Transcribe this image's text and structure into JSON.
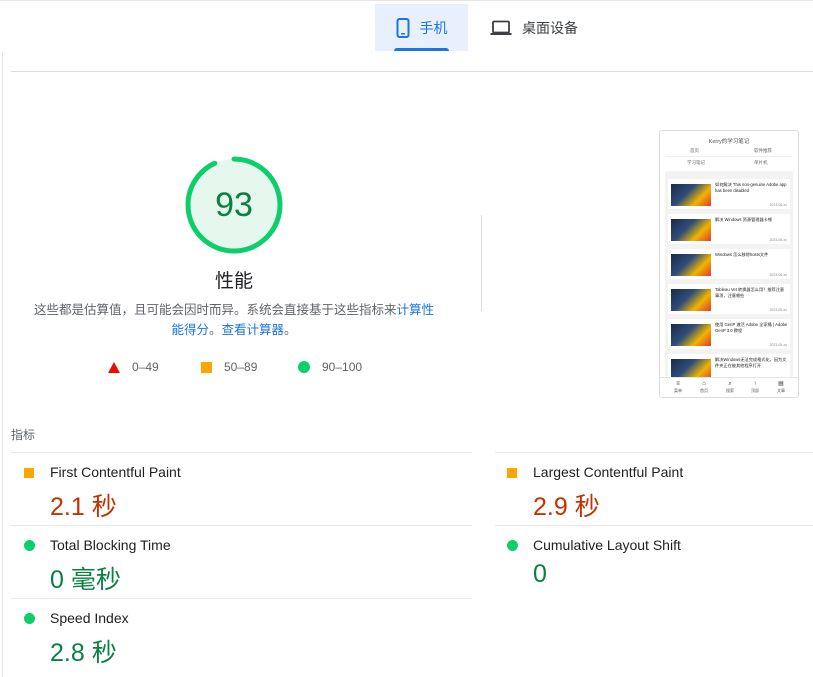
{
  "tabs": {
    "mobile": {
      "label": "手机",
      "icon": "smartphone-icon",
      "active": true
    },
    "desktop": {
      "label": "桌面设备",
      "icon": "laptop-icon",
      "active": false
    }
  },
  "gauge": {
    "score": "93",
    "score_value": 93,
    "title": "性能",
    "desc_prefix": "这些都是估算值，且可能会因时而异。系统会直接基于这些指标来",
    "desc_link1": "计算性能得分",
    "desc_mid": "。",
    "desc_link2": "查看计算器",
    "desc_suffix": "。",
    "color": "#0cce6b"
  },
  "legend": [
    {
      "label": "0–49",
      "shape": "triangle",
      "color": "#eb0f00"
    },
    {
      "label": "50–89",
      "shape": "square",
      "color": "#ffa400"
    },
    {
      "label": "90–100",
      "shape": "circle",
      "color": "#0cce6b"
    }
  ],
  "screenshot": {
    "site_title": "Kerry的学习笔记",
    "nav": [
      "首页",
      "软件推荐",
      "学习笔记",
      "单片机"
    ],
    "cards": [
      {
        "title": "如何解决 This non-genuine Adobe app has been disabled",
        "date": "2023-06-xx"
      },
      {
        "title": "解决 Windows 资源管理器卡顿",
        "date": "2023-06-xx"
      },
      {
        "title": "Windows 怎么移除hosts文件",
        "date": "2023-06-xx"
      },
      {
        "title": "Tableau Vet 转换器怎么用？推荐注意事项，注意哪些",
        "date": "2023-05-xx"
      },
      {
        "title": "使用 GenP 激活 Adobe 全家桶 | Adobe GenP 3.0 教程",
        "date": "2023-05-xx"
      },
      {
        "title": "解决Windows无法完成格式化，因为文件夹正在被其他程序打开",
        "date": ""
      }
    ],
    "bottom_nav": [
      {
        "glyph": "≡",
        "label": "菜单"
      },
      {
        "glyph": "⌂",
        "label": "首页"
      },
      {
        "glyph": "⌕",
        "label": "搜索"
      },
      {
        "glyph": "↑",
        "label": "顶部"
      },
      {
        "glyph": "▤",
        "label": "文章"
      }
    ]
  },
  "metrics": {
    "section_label": "指标",
    "items": [
      {
        "name": "First Contentful Paint",
        "value": "2.1 秒",
        "rating": "average"
      },
      {
        "name": "Largest Contentful Paint",
        "value": "2.9 秒",
        "rating": "average"
      },
      {
        "name": "Total Blocking Time",
        "value": "0 毫秒",
        "rating": "pass"
      },
      {
        "name": "Cumulative Layout Shift",
        "value": "0",
        "rating": "pass"
      },
      {
        "name": "Speed Index",
        "value": "2.8 秒",
        "rating": "pass"
      }
    ]
  },
  "colors": {
    "accent": "#1a73e8",
    "pass": "#0cce6b",
    "average": "#ffa400",
    "fail": "#eb0f00",
    "value_green": "#0b8043",
    "value_orange": "#c33300"
  }
}
